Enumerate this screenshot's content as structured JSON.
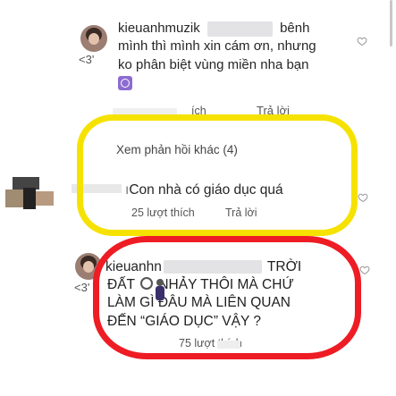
{
  "comment1": {
    "username": "kieuanhmuzik",
    "line1_tail": "bênh",
    "line2": "mình thì mình xin cám ơn, nhưng",
    "line3": "ko phân biệt vùng miền nha bạn",
    "reply_label": "Trả lời",
    "partial_meta": "ích"
  },
  "thread": {
    "view_more": "Xem phản hồi khác (4)"
  },
  "comment2": {
    "text": "Con nhà có giáo dục quá",
    "likes": "25 lượt thích",
    "reply_label": "Trả lời"
  },
  "comment3": {
    "username": "kieuanhn",
    "line1_tail": "TRỜI",
    "line2_a": "ĐẤT",
    "line2_b": "NHẢY THÔI MÀ CHỨ",
    "line3_a": "LÀM GÌ",
    "line3_b": "ĐÂU MÀ LIÊN QUAN",
    "line4": "ĐẾN “GIÁO DỤC” VẬY ?",
    "likes": "75 lượt thích"
  },
  "colors": {
    "highlight_yellow": "#f6e200",
    "highlight_red": "#ee1c24",
    "text": "#262626",
    "meta": "#555555"
  }
}
